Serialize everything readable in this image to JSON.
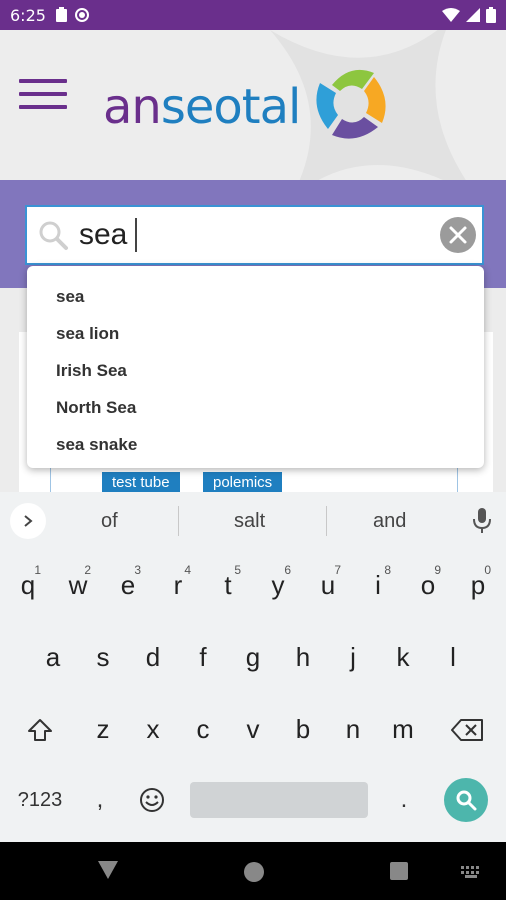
{
  "status_bar": {
    "time": "6:25"
  },
  "header": {
    "logo_text_a": "an",
    "logo_text_b": "seotal",
    "menu_icon": "hamburger-menu-icon",
    "colors": {
      "purple": "#6a2f8c",
      "blue": "#1f7fc0",
      "band": "#8176bd"
    }
  },
  "search": {
    "value": "sea"
  },
  "suggestions": [
    "sea",
    "sea lion",
    "Irish Sea",
    "North Sea",
    "sea snake"
  ],
  "content": {
    "tags": [
      "test tube",
      "polemics"
    ]
  },
  "keyboard": {
    "suggestions": [
      "of",
      "salt",
      "and"
    ],
    "row1": [
      {
        "k": "q",
        "h": "1"
      },
      {
        "k": "w",
        "h": "2"
      },
      {
        "k": "e",
        "h": "3"
      },
      {
        "k": "r",
        "h": "4"
      },
      {
        "k": "t",
        "h": "5"
      },
      {
        "k": "y",
        "h": "6"
      },
      {
        "k": "u",
        "h": "7"
      },
      {
        "k": "i",
        "h": "8"
      },
      {
        "k": "o",
        "h": "9"
      },
      {
        "k": "p",
        "h": "0"
      }
    ],
    "row2": [
      "a",
      "s",
      "d",
      "f",
      "g",
      "h",
      "j",
      "k",
      "l"
    ],
    "row3": [
      "z",
      "x",
      "c",
      "v",
      "b",
      "n",
      "m"
    ],
    "symbols_label": "?123",
    "comma": ",",
    "period": "."
  }
}
